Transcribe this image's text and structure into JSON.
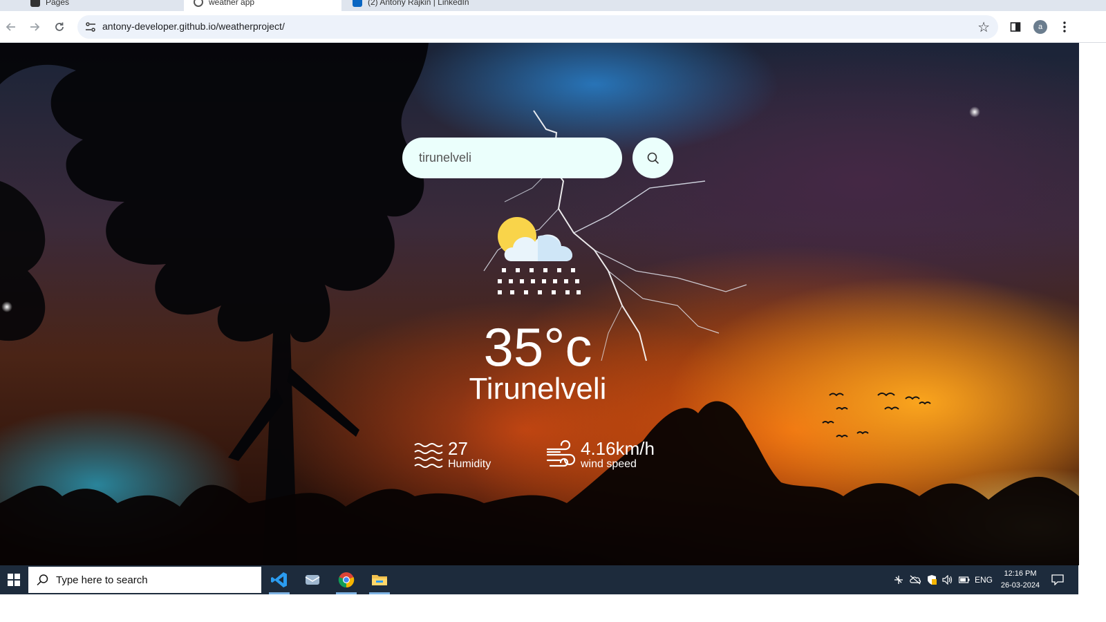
{
  "browser": {
    "tabs": [
      {
        "label": "Pages"
      },
      {
        "label": "weather app"
      },
      {
        "label": "(2) Antony Rajkin | LinkedIn"
      }
    ],
    "url": "antony-developer.github.io/weatherproject/",
    "profile_initial": "a"
  },
  "weather": {
    "search_value": "tirunelveli",
    "condition_icon": "sun-cloud-snow-icon",
    "temperature": "35°c",
    "city": "Tirunelveli",
    "humidity_value": "27",
    "humidity_label": "Humidity",
    "wind_value": "4.16km/h",
    "wind_label": "wind speed"
  },
  "taskbar": {
    "search_placeholder": "Type here to search",
    "apps": [
      "vscode-icon",
      "mail-icon",
      "chrome-icon",
      "file-explorer-icon"
    ],
    "language": "ENG",
    "time": "12:16 PM",
    "date": "26-03-2024"
  },
  "colors": {
    "input_bg": "#ebfffc",
    "taskbar_bg": "#1d2b3c",
    "omnibox_bg": "#edf2fa"
  }
}
